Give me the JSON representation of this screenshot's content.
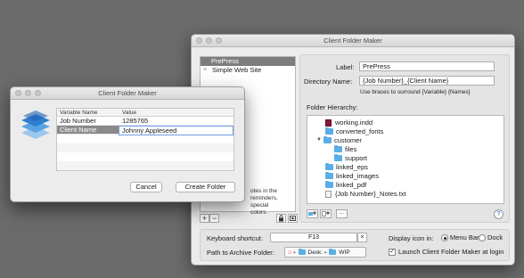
{
  "main_window": {
    "title": "Client Folder Maker",
    "presets": [
      {
        "label": "PrePress",
        "selected": true
      },
      {
        "label": "Simple Web Site",
        "selected": false
      }
    ],
    "list_note": "otes in the\nreminders, special\ncolors.",
    "add_label": "+",
    "remove_label": "−",
    "label_caption": "Label:",
    "label_value": "PrePress",
    "directory_caption": "Directory Name:",
    "directory_value": "{Job Number}_{Client Name}",
    "directory_hint": "Use braces to surround {Variable} {Names}",
    "hierarchy_caption": "Folder Hierarchy:",
    "tree": [
      {
        "name": "working.indd",
        "type": "indd",
        "indent": 0
      },
      {
        "name": "converted_fonts",
        "type": "folder",
        "indent": 0
      },
      {
        "name": "customer",
        "type": "folder",
        "indent": 0,
        "expanded": true
      },
      {
        "name": "files",
        "type": "folder",
        "indent": 1
      },
      {
        "name": "support",
        "type": "folder",
        "indent": 1
      },
      {
        "name": "linked_eps",
        "type": "folder",
        "indent": 0
      },
      {
        "name": "linked_images",
        "type": "folder",
        "indent": 0
      },
      {
        "name": "linked_pdf",
        "type": "folder",
        "indent": 0
      },
      {
        "name": "{Job Number}_Notes.txt",
        "type": "txt",
        "indent": 0
      }
    ],
    "help_label": "?",
    "shortcut_caption": "Keyboard shortcut:",
    "shortcut_value": "F13",
    "clear_label": "×",
    "archive_caption": "Path to Archive Folder:",
    "archive_path": [
      "Desk:",
      "WIP"
    ],
    "display_caption": "Display icon in:",
    "display_options": [
      {
        "label": "Menu Bar",
        "selected": true
      },
      {
        "label": "Dock",
        "selected": false
      }
    ],
    "launch_label": "Launch Client Folder Maker at login",
    "launch_checked": true
  },
  "dialog": {
    "title": "Client Folder Maker",
    "col_variable": "Variable Name",
    "col_value": "Value",
    "rows": [
      {
        "name": "Job Number",
        "value": "1285765"
      },
      {
        "name": "Client Name",
        "value": "Johnny Appleseed"
      }
    ],
    "cancel_label": "Cancel",
    "create_label": "Create Folder"
  },
  "colors": {
    "desktop": "#6b6b6b",
    "folder": "#5aaee5",
    "selection": "#7d7d7d",
    "focus_ring": "#6f9be0"
  }
}
